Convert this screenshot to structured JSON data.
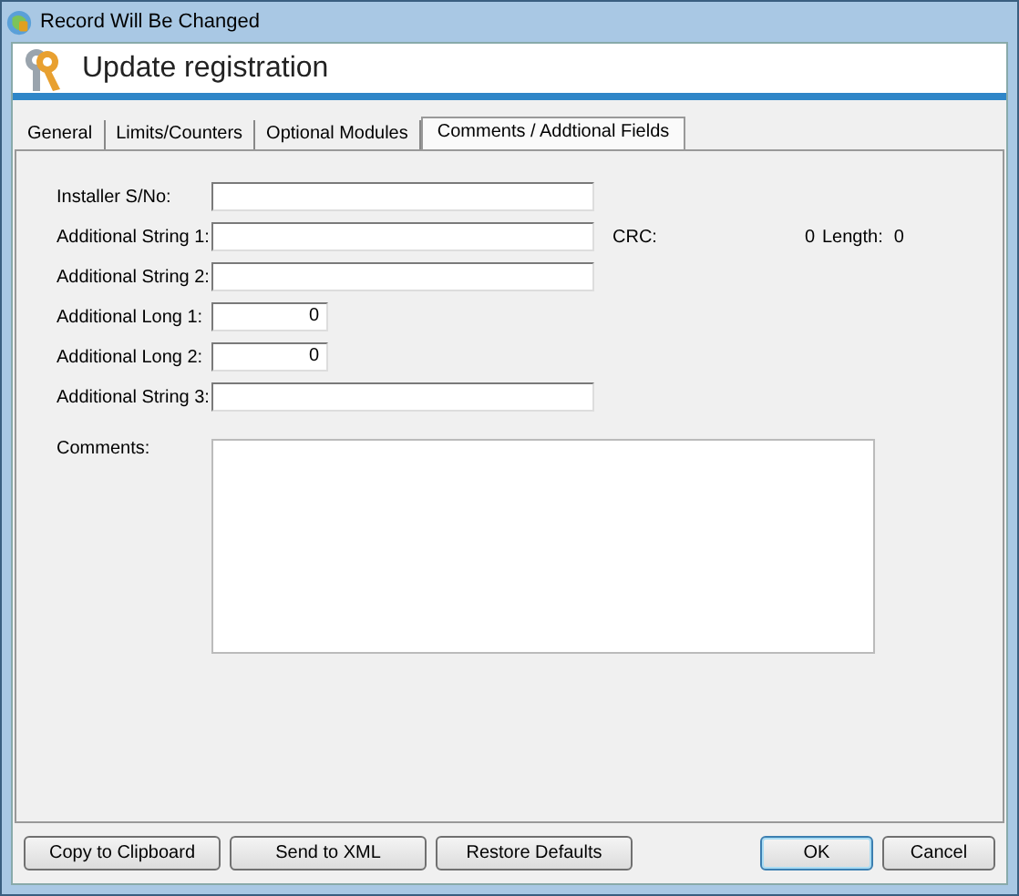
{
  "window": {
    "title": "Record Will Be Changed"
  },
  "header": {
    "title": "Update registration"
  },
  "tabs": [
    {
      "label": "General",
      "selected": false
    },
    {
      "label": "Limits/Counters",
      "selected": false
    },
    {
      "label": "Optional Modules",
      "selected": false
    },
    {
      "label": "Comments / Addtional Fields",
      "selected": true
    }
  ],
  "fields": [
    {
      "label": "Installer S/No:",
      "kind": "text"
    },
    {
      "label": "Additional String 1:",
      "kind": "text"
    },
    {
      "label": "Additional String 2:",
      "kind": "text"
    },
    {
      "label": "Additional Long 1:",
      "kind": "number",
      "value": "0"
    },
    {
      "label": "Additional Long 2:",
      "kind": "number",
      "value": "0"
    },
    {
      "label": "Additional String 3:",
      "kind": "text"
    }
  ],
  "crc": {
    "label": "CRC:",
    "value": "0",
    "length_label": "Length:",
    "length_value": "0"
  },
  "comments": {
    "label": "Comments:"
  },
  "buttons": {
    "left": [
      {
        "label": "Copy to Clipboard",
        "default": false
      },
      {
        "label": "Send to XML",
        "default": false
      },
      {
        "label": "Restore Defaults",
        "default": false
      }
    ],
    "right": [
      {
        "label": "OK",
        "default": true
      },
      {
        "label": "Cancel",
        "default": false
      }
    ]
  }
}
